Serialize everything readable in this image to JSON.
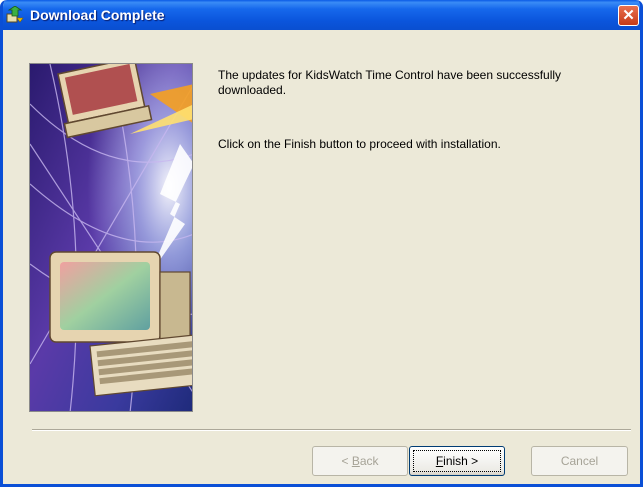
{
  "window": {
    "title": "Download Complete",
    "close_glyph": "✕"
  },
  "icons": {
    "title_icon": "installer-arrow-icon",
    "close": "close-icon"
  },
  "content": {
    "message_line1": "The updates for KidsWatch Time Control have been successfully downloaded.",
    "message_line2": "Click on the Finish button to proceed with installation."
  },
  "buttons": {
    "back": {
      "prefix": "< ",
      "mnemonic": "B",
      "rest": "ack",
      "enabled": false
    },
    "finish": {
      "mnemonic": "F",
      "rest": "inish >",
      "enabled": true,
      "default": true
    },
    "cancel": {
      "label": "Cancel",
      "enabled": false
    }
  },
  "colors": {
    "titlebar": "#0a5ae6",
    "window_bg": "#ece9d8",
    "close_button": "#d5482a",
    "disabled_text": "#a6a397"
  }
}
